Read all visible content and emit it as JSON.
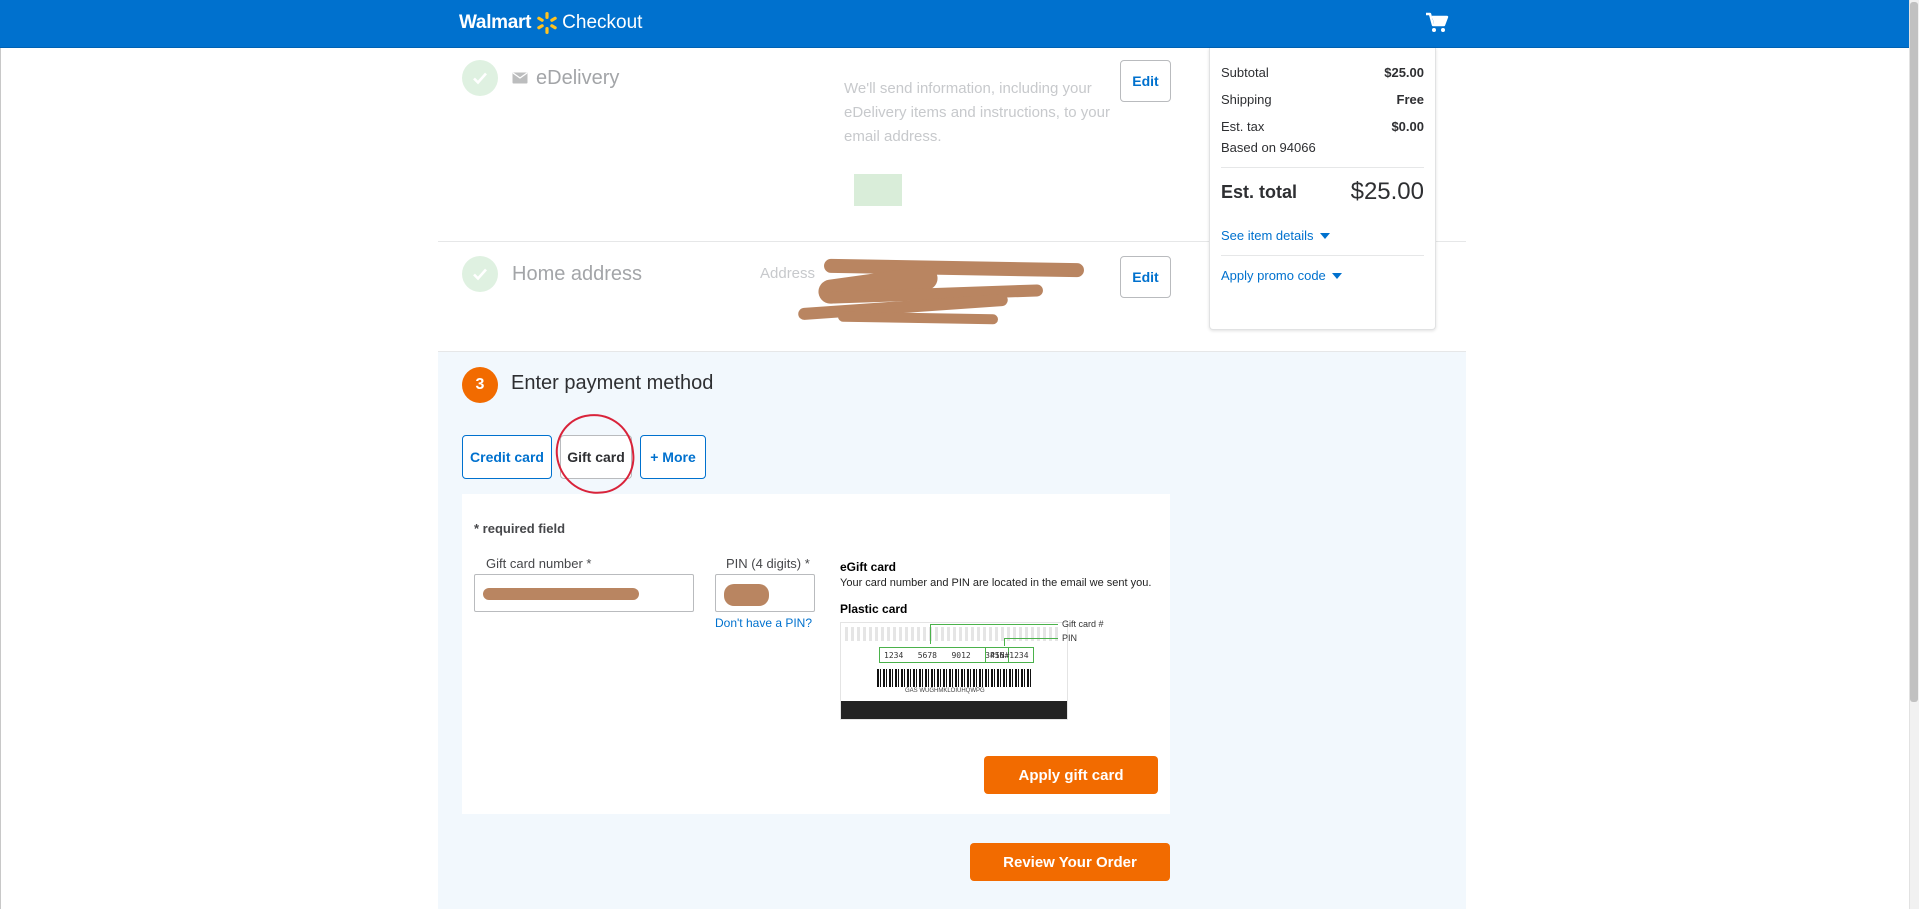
{
  "header": {
    "brand": "Walmart",
    "title": "Checkout",
    "colors": {
      "header_bg": "#0071ce",
      "spark": "#ffc220"
    }
  },
  "edelivery": {
    "title": "eDelivery",
    "info": "We'll send information, including your eDelivery items and instructions, to your email address.",
    "edit_label": "Edit"
  },
  "address": {
    "title": "Home address",
    "label": "Address",
    "edit_label": "Edit"
  },
  "payment": {
    "step_number": "3",
    "title": "Enter payment method",
    "tabs": {
      "credit": "Credit card",
      "gift": "Gift card",
      "more": "+ More"
    },
    "required_note": "* required field",
    "gift_card_label": "Gift card number *",
    "pin_label": "PIN (4 digits) *",
    "pin_help": "Don't have a PIN?",
    "egift_title": "eGift card",
    "egift_desc": "Your card number and PIN are located in the email we sent you.",
    "plastic_title": "Plastic card",
    "card_image": {
      "groups": [
        "1234",
        "5678",
        "9012",
        "3456"
      ],
      "pin_text": "PIN#1234",
      "barcode_text": "GAS WUGHMKLOIUHQWPG",
      "callout_number": "Gift card #",
      "callout_pin": "PIN"
    },
    "apply_label": "Apply gift card",
    "review_label": "Review Your Order",
    "accent_color": "#f26b00"
  },
  "summary": {
    "subtotal_label": "Subtotal",
    "subtotal": "$25.00",
    "shipping_label": "Shipping",
    "shipping": "Free",
    "tax_label": "Est. tax",
    "tax": "$0.00",
    "tax_note": "Based on 94066",
    "total_label": "Est. total",
    "total": "$25.00",
    "item_details_link": "See item details",
    "promo_link": "Apply promo code"
  }
}
